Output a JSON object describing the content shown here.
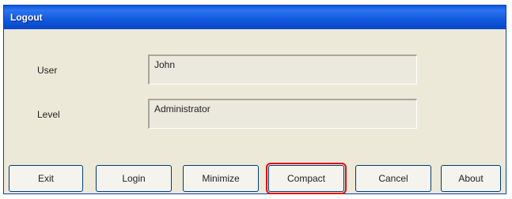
{
  "window": {
    "title": "Logout"
  },
  "fields": {
    "user_label": "User",
    "user_value": "John",
    "level_label": "Level",
    "level_value": "Administrator"
  },
  "buttons": {
    "exit": "Exit",
    "login": "Login",
    "minimize": "Minimize",
    "compact": "Compact",
    "cancel": "Cancel",
    "about": "About"
  },
  "highlight_color": "#e01010"
}
